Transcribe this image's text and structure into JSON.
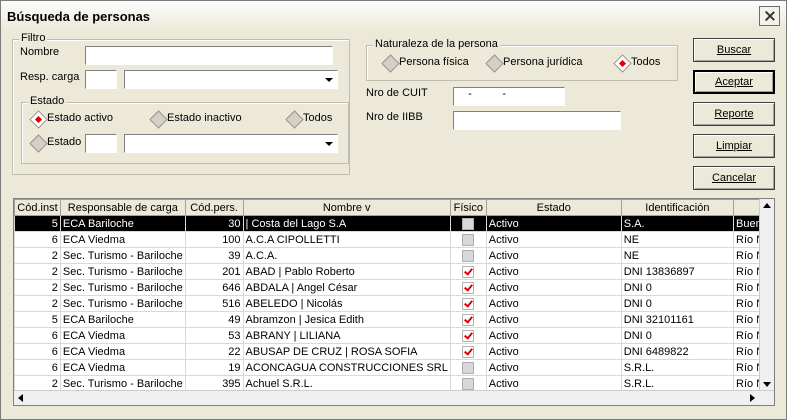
{
  "window": {
    "title": "Búsqueda de personas"
  },
  "filtro": {
    "label": "Filtro",
    "nombre_label": "Nombre",
    "nombre_value": "",
    "resp_carga_label": "Resp. carga",
    "resp_carga_code": "",
    "resp_carga_value": "",
    "estado_group_label": "Estado",
    "estado_activo_label": "Estado activo",
    "estado_inactivo_label": "Estado inactivo",
    "estado_todos_label": "Todos",
    "estado_label": "Estado",
    "estado_code": "",
    "estado_value": "",
    "estado_selected": "Estado activo"
  },
  "naturaleza": {
    "label": "Naturaleza de la persona",
    "fisica_label": "Persona física",
    "juridica_label": "Persona jurídica",
    "todos_label": "Todos",
    "selected": "Todos"
  },
  "cuit": {
    "label": "Nro de CUIT",
    "value": "  -          -  "
  },
  "iibb": {
    "label": "Nro de IIBB",
    "value": ""
  },
  "buttons": {
    "buscar": "Buscar",
    "aceptar": "Aceptar",
    "reporte": "Reporte",
    "limpiar": "Limpiar",
    "cancelar": "Cancelar"
  },
  "grid": {
    "columns": [
      "Cód.inst",
      "Responsable de carga",
      "Cód.pers.",
      "Nombre   v",
      "Físico",
      "Estado",
      "Identificación",
      ""
    ],
    "rows": [
      {
        "cod_inst": "5",
        "responsable": "ECA Bariloche",
        "cod_pers": "30",
        "nombre": "| Costa del Lago  S.A",
        "fisico": false,
        "estado": "Activo",
        "identificacion": "S.A.",
        "extra": "Bueno"
      },
      {
        "cod_inst": "6",
        "responsable": "ECA Viedma",
        "cod_pers": "100",
        "nombre": "A.C.A CIPOLLETTI",
        "fisico": false,
        "estado": "Activo",
        "identificacion": "NE",
        "extra": "Río N"
      },
      {
        "cod_inst": "2",
        "responsable": "Sec. Turismo - Bariloche",
        "cod_pers": "39",
        "nombre": "A.C.A.",
        "fisico": false,
        "estado": "Activo",
        "identificacion": "NE",
        "extra": "Río N"
      },
      {
        "cod_inst": "2",
        "responsable": "Sec. Turismo - Bariloche",
        "cod_pers": "201",
        "nombre": "ABAD | Pablo Roberto",
        "fisico": true,
        "estado": "Activo",
        "identificacion": "DNI 13836897",
        "extra": "Río N"
      },
      {
        "cod_inst": "2",
        "responsable": "Sec. Turismo - Bariloche",
        "cod_pers": "646",
        "nombre": "ABDALA | Angel César",
        "fisico": true,
        "estado": "Activo",
        "identificacion": "DNI 0",
        "extra": "Río N"
      },
      {
        "cod_inst": "2",
        "responsable": "Sec. Turismo - Bariloche",
        "cod_pers": "516",
        "nombre": "ABELEDO | Nicolás",
        "fisico": true,
        "estado": "Activo",
        "identificacion": "DNI 0",
        "extra": "Río N"
      },
      {
        "cod_inst": "5",
        "responsable": "ECA Bariloche",
        "cod_pers": "49",
        "nombre": "Abramzon | Jesica Edith",
        "fisico": true,
        "estado": "Activo",
        "identificacion": "DNI 32101161",
        "extra": "Río N"
      },
      {
        "cod_inst": "6",
        "responsable": "ECA Viedma",
        "cod_pers": "53",
        "nombre": "ABRANY | LILIANA",
        "fisico": true,
        "estado": "Activo",
        "identificacion": "DNI 0",
        "extra": "Río N"
      },
      {
        "cod_inst": "6",
        "responsable": "ECA Viedma",
        "cod_pers": "22",
        "nombre": "ABUSAP DE CRUZ | ROSA SOFIA",
        "fisico": true,
        "estado": "Activo",
        "identificacion": "DNI 6489822",
        "extra": "Río N"
      },
      {
        "cod_inst": "6",
        "responsable": "ECA Viedma",
        "cod_pers": "19",
        "nombre": "ACONCAGUA CONSTRUCCIONES SRL",
        "fisico": false,
        "estado": "Activo",
        "identificacion": "S.R.L.",
        "extra": "Río N"
      },
      {
        "cod_inst": "2",
        "responsable": "Sec. Turismo - Bariloche",
        "cod_pers": "395",
        "nombre": "Achuel S.R.L.",
        "fisico": false,
        "estado": "Activo",
        "identificacion": "S.R.L.",
        "extra": "Río N"
      }
    ],
    "selected_row": 0
  },
  "colors": {
    "selection_bg": "#000000",
    "check_red": "#e00000",
    "window_bg": "#ece9d8"
  }
}
